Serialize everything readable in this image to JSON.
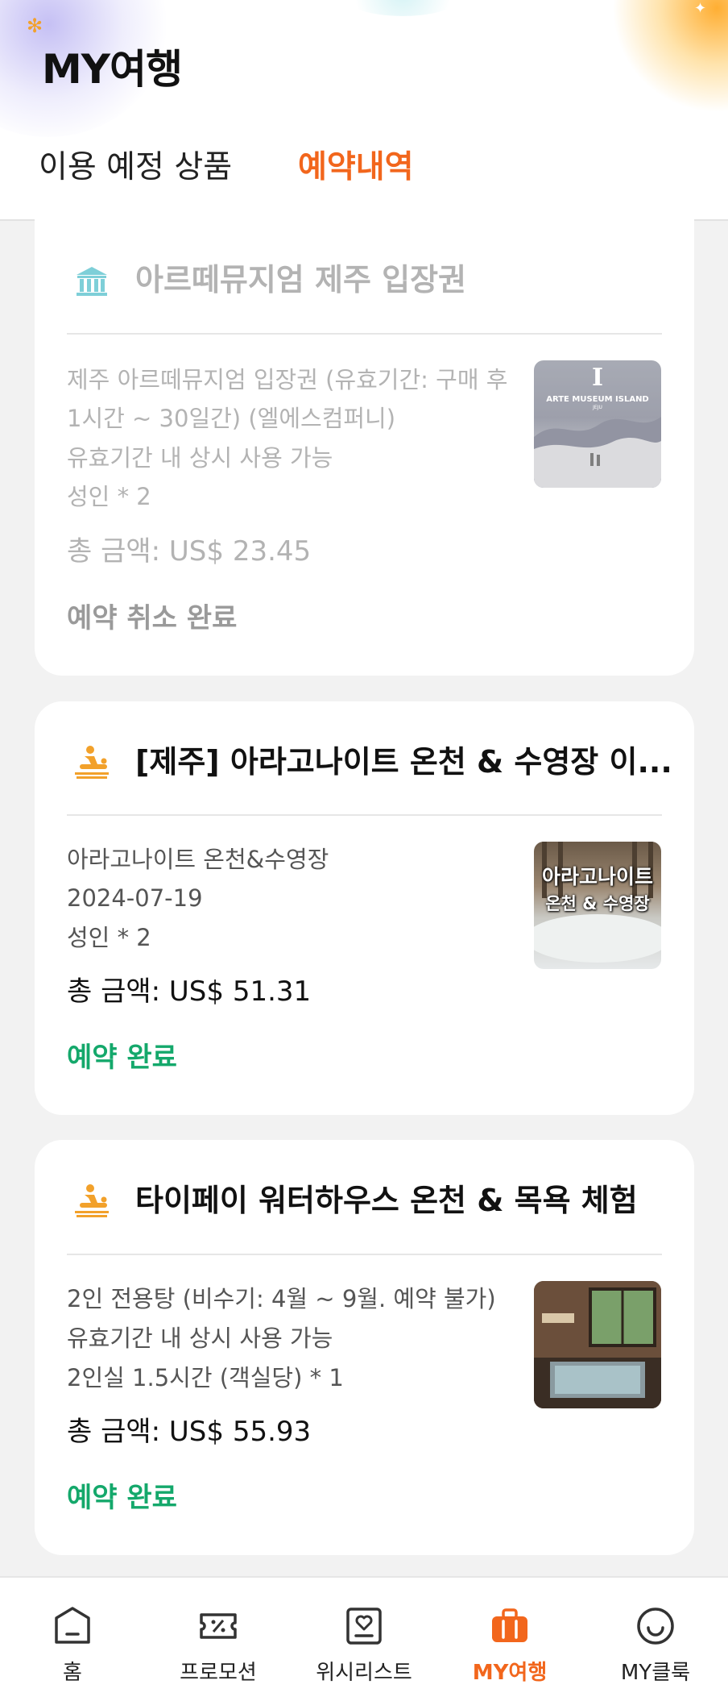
{
  "header": {
    "title": "MY여행",
    "tabs": [
      {
        "label": "이용 예정 상품",
        "active": false
      },
      {
        "label": "예약내역",
        "active": true
      }
    ]
  },
  "reservations": [
    {
      "icon": "museum-icon",
      "title": "아르떼뮤지엄 제주 입장권",
      "lines": [
        "제주 아르떼뮤지엄 입장권 (유효기간: 구매 후",
        "1시간 ~ 30일간) (엘에스컴퍼니)",
        "유효기간 내 상시 사용 가능",
        " 성인 * 2"
      ],
      "total": "총 금액: US$ 23.45",
      "status": "예약 취소 완료",
      "thumbnail_text": "ARTE MUSEUM ISLAND",
      "thumbnail_logo": "I",
      "thumbnail_sub": "JEJU",
      "cancelled": true
    },
    {
      "icon": "spa-icon",
      "title": "[제주] 아라고나이트 온천 & 수영장 이...",
      "lines": [
        "아라고나이트 온천&수영장",
        "2024-07-19",
        " 성인 * 2"
      ],
      "total": "총 금액: US$ 51.31",
      "status": "예약 완료",
      "thumbnail_text_1": "아라고나이트",
      "thumbnail_text_2": "온천 & 수영장",
      "cancelled": false
    },
    {
      "icon": "spa-icon",
      "title": "타이페이 워터하우스 온천 & 목욕 체험",
      "lines": [
        "2인 전용탕 (비수기: 4월 ~ 9월. 예약 불가)",
        "유효기간 내 상시 사용 가능",
        " 2인실 1.5시간 (객실당) * 1"
      ],
      "total": "총 금액: US$ 55.93",
      "status": "예약 완료",
      "cancelled": false
    }
  ],
  "bottom_nav": [
    {
      "label": "홈",
      "icon": "home-icon",
      "active": false
    },
    {
      "label": "프로모션",
      "icon": "coupon-icon",
      "active": false
    },
    {
      "label": "위시리스트",
      "icon": "wishlist-icon",
      "active": false
    },
    {
      "label": "MY여행",
      "icon": "suitcase-icon",
      "active": true
    },
    {
      "label": "MY클룩",
      "icon": "smiley-icon",
      "active": false
    }
  ],
  "colors": {
    "accent": "#f2661c",
    "success": "#14a86b",
    "spa_icon": "#f2a12b",
    "museum_icon": "#7ecfd8"
  }
}
